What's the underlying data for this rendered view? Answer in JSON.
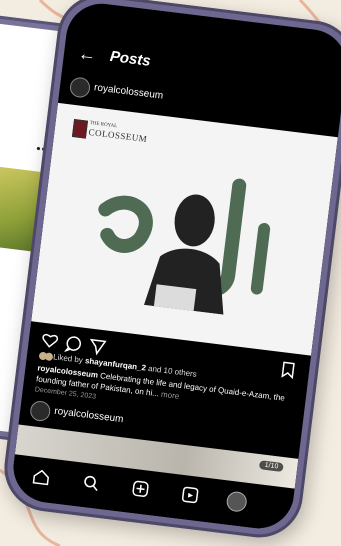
{
  "colors": {
    "background": "#f3ece0",
    "accent_rings": "#e8b59a",
    "phone_frame": "#6e6790",
    "calligraphy": "#4f6b53"
  },
  "screen": {
    "title": "Posts",
    "post": {
      "username": "royalcolosseum",
      "logo": {
        "subtitle": "THE ROYAL",
        "title": "COLOSSEUM"
      },
      "likes_prefix": "Liked by",
      "liked_by": "shayanfurqan_2",
      "likes_suffix": "and 10 others",
      "caption_user": "royalcolosseum",
      "caption_text": "Celebrating the life and legacy of Quaid-e-Azam, the founding father of Pakistan, on hi...",
      "more": "more",
      "date": "December 25, 2023"
    },
    "next_post": {
      "username": "royalcolosseum",
      "counter": "1/10"
    },
    "icons": [
      "back-arrow-icon",
      "heart-icon",
      "comment-icon",
      "share-icon",
      "bookmark-icon",
      "home-icon",
      "search-icon",
      "create-icon",
      "reels-icon",
      "profile-icon"
    ]
  }
}
